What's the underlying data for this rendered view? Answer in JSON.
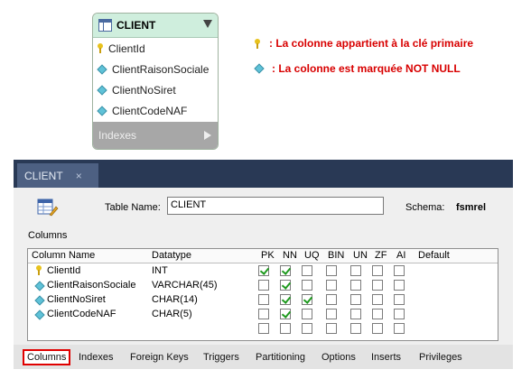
{
  "entity": {
    "title": "CLIENT",
    "columns": [
      {
        "name": "ClientId",
        "icon": "key-icon"
      },
      {
        "name": "ClientRaisonSociale",
        "icon": "diamond-icon"
      },
      {
        "name": "ClientNoSiret",
        "icon": "diamond-icon"
      },
      {
        "name": "ClientCodeNAF",
        "icon": "diamond-icon"
      }
    ],
    "indexes_label": "Indexes"
  },
  "legend": {
    "pk_text": ": La colonne appartient à la clé primaire",
    "nn_text": ": La colonne est marquée NOT NULL"
  },
  "editor": {
    "tab_label": "CLIENT",
    "close_glyph": "×",
    "table_name_label": "Table Name:",
    "table_name_value": "CLIENT",
    "schema_label": "Schema:",
    "schema_value": "fsmrel",
    "columns_caption": "Columns",
    "headers": [
      "Column Name",
      "Datatype",
      "PK",
      "NN",
      "UQ",
      "BIN",
      "UN",
      "ZF",
      "AI",
      "Default"
    ],
    "rows": [
      {
        "name": "ClientId",
        "type": "INT",
        "flags": [
          true,
          true,
          false,
          false,
          false,
          false,
          false
        ]
      },
      {
        "name": "ClientRaisonSociale",
        "type": "VARCHAR(45)",
        "flags": [
          false,
          true,
          false,
          false,
          false,
          false,
          false
        ]
      },
      {
        "name": "ClientNoSiret",
        "type": "CHAR(14)",
        "flags": [
          false,
          true,
          true,
          false,
          false,
          false,
          false
        ]
      },
      {
        "name": "ClientCodeNAF",
        "type": "CHAR(5)",
        "flags": [
          false,
          true,
          false,
          false,
          false,
          false,
          false
        ]
      }
    ],
    "bottom_tabs": [
      "Columns",
      "Indexes",
      "Foreign Keys",
      "Triggers",
      "Partitioning",
      "Options",
      "Inserts",
      "Privileges"
    ],
    "active_tab": "Columns"
  },
  "colors": {
    "legend_text": "#d80000",
    "tabbar": "#293955",
    "checkmark": "#1e9a1e"
  }
}
